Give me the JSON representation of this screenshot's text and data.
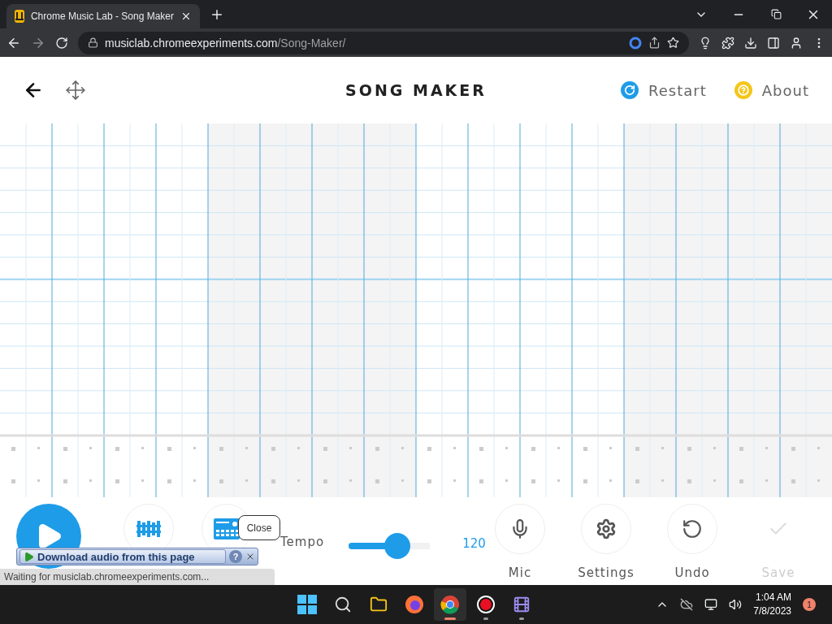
{
  "browser": {
    "tab": {
      "title": "Chrome Music Lab - Song Maker",
      "selected": true
    },
    "url_host": "musiclab.chromeexperiments.com",
    "url_path": "/Song-Maker/"
  },
  "header": {
    "title": "SONG MAKER",
    "buttons": [
      {
        "kind": "restart",
        "label": "Restart"
      },
      {
        "kind": "about",
        "label": "About"
      }
    ]
  },
  "instruments": [
    {
      "kind": "marimba"
    },
    {
      "kind": "electronic"
    }
  ],
  "tempo": {
    "label": "Tempo",
    "level": 0.6,
    "reading": "120"
  },
  "actions": [
    {
      "kind": "mic",
      "label": "Mic",
      "disabled": false
    },
    {
      "kind": "settings",
      "label": "Settings",
      "disabled": false
    },
    {
      "kind": "undo",
      "label": "Undo",
      "disabled": false
    },
    {
      "kind": "save",
      "label": "Save",
      "disabled": true
    }
  ],
  "overlays": {
    "tooltip": "Close",
    "download_bar": {
      "label": "Download audio from this page",
      "help": "?"
    },
    "status": "Waiting for musiclab.chromeexperiments.com..."
  },
  "taskbar": {
    "apps": [
      {
        "kind": "start",
        "selected": false
      },
      {
        "kind": "search",
        "selected": false
      },
      {
        "kind": "files",
        "selected": false
      },
      {
        "kind": "firefox",
        "selected": false
      },
      {
        "kind": "chrome",
        "selected": true
      },
      {
        "kind": "record",
        "selected": false
      },
      {
        "kind": "video",
        "selected": false
      }
    ],
    "time": "1:04 AM",
    "date": "7/8/2023",
    "notifications": "1"
  }
}
